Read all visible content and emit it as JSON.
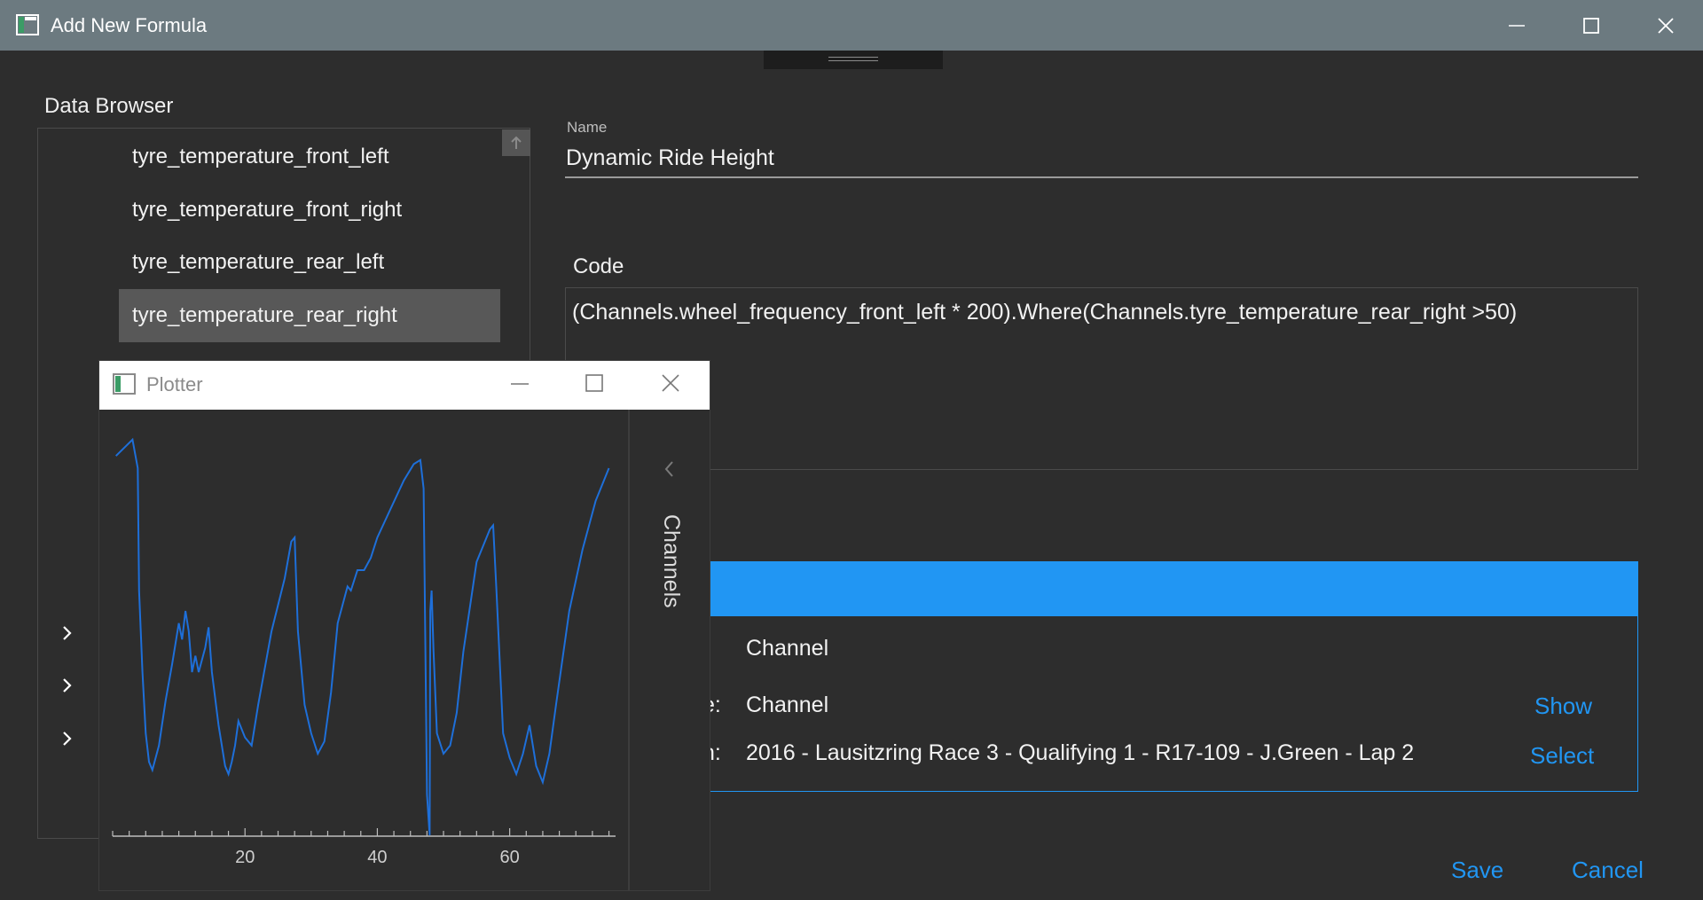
{
  "window": {
    "title": "Add New Formula"
  },
  "data_browser": {
    "title": "Data Browser",
    "items": [
      {
        "label": "tyre_temperature_front_left",
        "selected": false
      },
      {
        "label": "tyre_temperature_front_right",
        "selected": false
      },
      {
        "label": "tyre_temperature_rear_left",
        "selected": false
      },
      {
        "label": "tyre_temperature_rear_right",
        "selected": true
      }
    ],
    "expanders": [
      "chevron-right-icon",
      "chevron-right-icon",
      "chevron-right-icon"
    ]
  },
  "form": {
    "name_label": "Name",
    "name_value": "Dynamic Ride Height",
    "code_label": "Code",
    "code_value": "(Channels.wheel_frequency_front_left * 200).Where(Channels.tyre_temperature_rear_right >50)"
  },
  "info": {
    "rows": [
      {
        "label_fragment": ":",
        "value": "Channel"
      },
      {
        "label_fragment": "e:",
        "value": "Channel"
      },
      {
        "label_fragment": "n:",
        "value": "2016 - Lausitzring Race 3 - Qualifying 1 - R17-109 - J.Green - Lap 2"
      }
    ],
    "show_link": "Show",
    "select_link": "Select"
  },
  "actions": {
    "save": "Save",
    "cancel": "Cancel"
  },
  "plotter": {
    "title": "Plotter",
    "side_label": "Channels",
    "line_color": "#1e6fd9"
  },
  "chart_data": {
    "type": "line",
    "xlim": [
      0,
      76
    ],
    "ylim": [
      0,
      100
    ],
    "x_ticks": [
      20,
      40,
      60
    ],
    "series": [
      {
        "color": "#1e6fd9",
        "x": [
          0.5,
          3,
          3.8,
          4,
          4.5,
          5,
          5.5,
          6,
          7,
          8,
          9,
          10,
          10.5,
          11,
          11.5,
          12,
          12.5,
          13,
          14,
          14.5,
          15,
          16,
          17,
          17.5,
          18,
          18.5,
          19,
          20,
          21,
          22,
          24,
          26,
          27,
          27.5,
          28,
          29,
          30,
          31,
          32,
          33,
          34,
          35,
          35.5,
          36,
          37,
          38,
          39,
          40,
          42,
          44,
          45.5,
          46.5,
          47,
          47.5,
          47.9,
          48,
          48.2,
          48.5,
          49,
          50,
          51,
          52,
          53,
          55,
          57,
          57.5,
          58,
          59,
          60,
          61,
          62,
          63,
          64,
          65,
          66,
          67,
          69,
          71,
          73,
          75
        ],
        "y": [
          93,
          97,
          90,
          60,
          40,
          25,
          18,
          16,
          22,
          33,
          42,
          52,
          48,
          55,
          50,
          40,
          44,
          40,
          46,
          51,
          40,
          27,
          17,
          15,
          18,
          22,
          28,
          24,
          22,
          32,
          50,
          63,
          72,
          73,
          50,
          32,
          25,
          20,
          23,
          35,
          52,
          58,
          61,
          60,
          65,
          65,
          68,
          73,
          80,
          87,
          91,
          92,
          85,
          10,
          0,
          55,
          60,
          45,
          25,
          20,
          22,
          30,
          45,
          67,
          75,
          76,
          60,
          25,
          19,
          15,
          20,
          27,
          17,
          13,
          20,
          32,
          55,
          70,
          82,
          90
        ]
      }
    ]
  }
}
